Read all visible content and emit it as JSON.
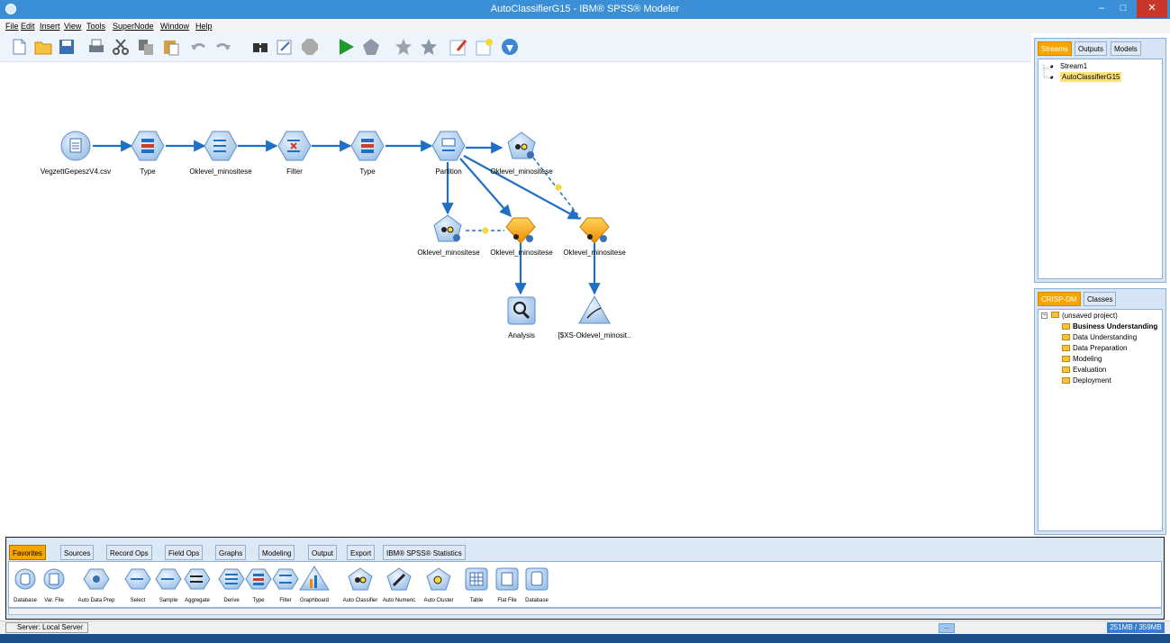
{
  "window": {
    "title": "AutoClassifierG15 - IBM® SPSS® Modeler"
  },
  "menu": [
    "File",
    "Edit",
    "Insert",
    "View",
    "Tools",
    "SuperNode",
    "Window",
    "Help"
  ],
  "toolbar_icons": [
    "new-stream-icon",
    "open-icon",
    "save-icon",
    "print-icon",
    "cut-icon",
    "copy-icon",
    "paste-icon",
    "undo-icon",
    "redo-icon",
    "find-icon",
    "edit-icon",
    "stop-icon",
    "run-icon",
    "run-selection-icon",
    "favorite-icon",
    "favorite-2-icon",
    "annotation-icon",
    "add-comment-icon",
    "help-icon"
  ],
  "stream": {
    "nodes": [
      {
        "id": "src",
        "label": "VegzettGepeszV4.csv",
        "icon": "var-file-icon"
      },
      {
        "id": "type1",
        "label": "Type",
        "icon": "type-node-icon"
      },
      {
        "id": "derive1",
        "label": "Oklevel_minositese",
        "icon": "derive-node-icon"
      },
      {
        "id": "filter",
        "label": "Filter",
        "icon": "filter-node-icon"
      },
      {
        "id": "type2",
        "label": "Type",
        "icon": "type-node-icon"
      },
      {
        "id": "partition",
        "label": "Partition",
        "icon": "partition-node-icon"
      },
      {
        "id": "autoclass1",
        "label": "Oklevel_minositese",
        "icon": "auto-classifier-node-icon"
      },
      {
        "id": "autoclass2",
        "label": "Oklevel_minositese",
        "icon": "auto-classifier-node-icon"
      },
      {
        "id": "nugget1",
        "label": "Oklevel_minositese",
        "icon": "model-nugget-icon"
      },
      {
        "id": "nugget2",
        "label": "Oklevel_minositese",
        "icon": "model-nugget-icon"
      },
      {
        "id": "analysis",
        "label": "Analysis",
        "icon": "analysis-node-icon"
      },
      {
        "id": "evaluation",
        "label": "[$XS-Oklevel_minosit..",
        "icon": "evaluation-node-icon"
      }
    ]
  },
  "streams_panel": {
    "tabs": [
      "Streams",
      "Outputs",
      "Models"
    ],
    "items": [
      "Stream1",
      "AutoClassifierG15"
    ]
  },
  "crisp_panel": {
    "tabs": [
      "CRISP-DM",
      "Classes"
    ],
    "root": "(unsaved project)",
    "items": [
      "Business Understanding",
      "Data Understanding",
      "Data Preparation",
      "Modeling",
      "Evaluation",
      "Deployment"
    ]
  },
  "palette": {
    "tabs": [
      "Favorites",
      "Sources",
      "Record Ops",
      "Field Ops",
      "Graphs",
      "Modeling",
      "Output",
      "Export",
      "IBM® SPSS® Statistics"
    ],
    "items": [
      "Database",
      "Var. File",
      "Auto Data Prep",
      "Select",
      "Sample",
      "Aggregate",
      "Derive",
      "Type",
      "Filter",
      "Graphboard",
      "Auto Classifier",
      "Auto Numeric",
      "Auto Cluster",
      "Table",
      "Flat File",
      "Database"
    ]
  },
  "status": {
    "server": "Server: Local Server",
    "memory": "251MB / 359MB",
    "ellipsis": "..."
  },
  "colors": {
    "accent": "#f7a600",
    "titlebar": "#3a8fd6",
    "link": "#1f6fc5"
  }
}
